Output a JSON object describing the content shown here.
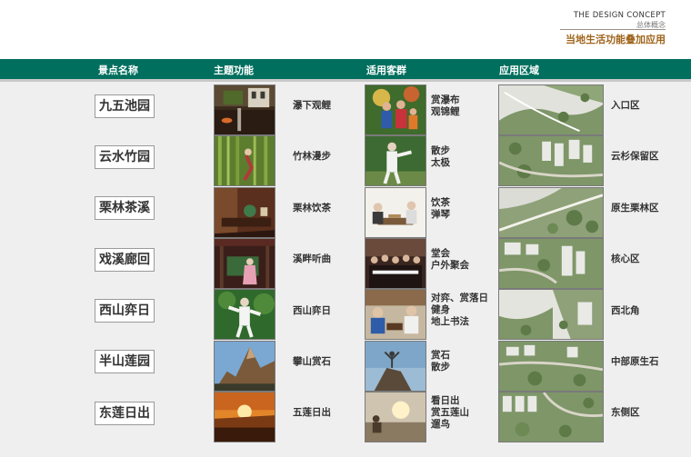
{
  "brand": {
    "english": "THE DESIGN CONCEPT",
    "chinese": "总体概念",
    "subtitle": "当地生活功能叠加应用"
  },
  "columns": {
    "spot": "景点名称",
    "theme": "主题功能",
    "audience": "适用客群",
    "area": "应用区域"
  },
  "rows": [
    {
      "name": "九五池园",
      "theme": "瀑下观鲤",
      "audience": [
        "赏瀑布",
        "观锦鲤"
      ],
      "area": "入口区"
    },
    {
      "name": "云水竹园",
      "theme": "竹林漫步",
      "audience": [
        "散步",
        "太极"
      ],
      "area": "云杉保留区"
    },
    {
      "name": "栗林茶溪",
      "theme": "栗林饮茶",
      "audience": [
        "饮茶",
        "弹琴"
      ],
      "area": "原生栗林区"
    },
    {
      "name": "戏溪廊回",
      "theme": "溪畔听曲",
      "audience": [
        "堂会",
        "户外聚会"
      ],
      "area": "核心区"
    },
    {
      "name": "西山弈日",
      "theme": "西山弈日",
      "audience": [
        "对弈、赏落日",
        "健身",
        "地上书法"
      ],
      "area": "西北角"
    },
    {
      "name": "半山莲园",
      "theme": "攀山赏石",
      "audience": [
        "赏石",
        "散步"
      ],
      "area": "中部原生石"
    },
    {
      "name": "东莲日出",
      "theme": "五莲日出",
      "audience": [
        "看日出",
        "赏五莲山",
        "遛鸟"
      ],
      "area": "东侧区"
    }
  ],
  "icons": {
    "theme_photos": [
      "waterfall-koi-photo",
      "bamboo-walk-photo",
      "tea-table-photo",
      "pavilion-music-photo",
      "tai-chi-photo",
      "mountain-rock-photo",
      "sunrise-photo"
    ],
    "audience_photos": [
      "family-outing-photo",
      "elder-tai-chi-photo",
      "tea-and-guqin-photo",
      "indoor-gathering-photo",
      "chess-players-photo",
      "person-on-rock-photo",
      "beach-sunrise-photo"
    ],
    "plan_maps": [
      "entrance-plan-map",
      "fir-reserve-plan-map",
      "chestnut-forest-plan-map",
      "core-area-plan-map",
      "northwest-plan-map",
      "central-rock-plan-map",
      "east-side-plan-map"
    ]
  },
  "colors": {
    "header_bar": "#006f5e",
    "accent": "#a0651d",
    "band": "#efefef"
  }
}
